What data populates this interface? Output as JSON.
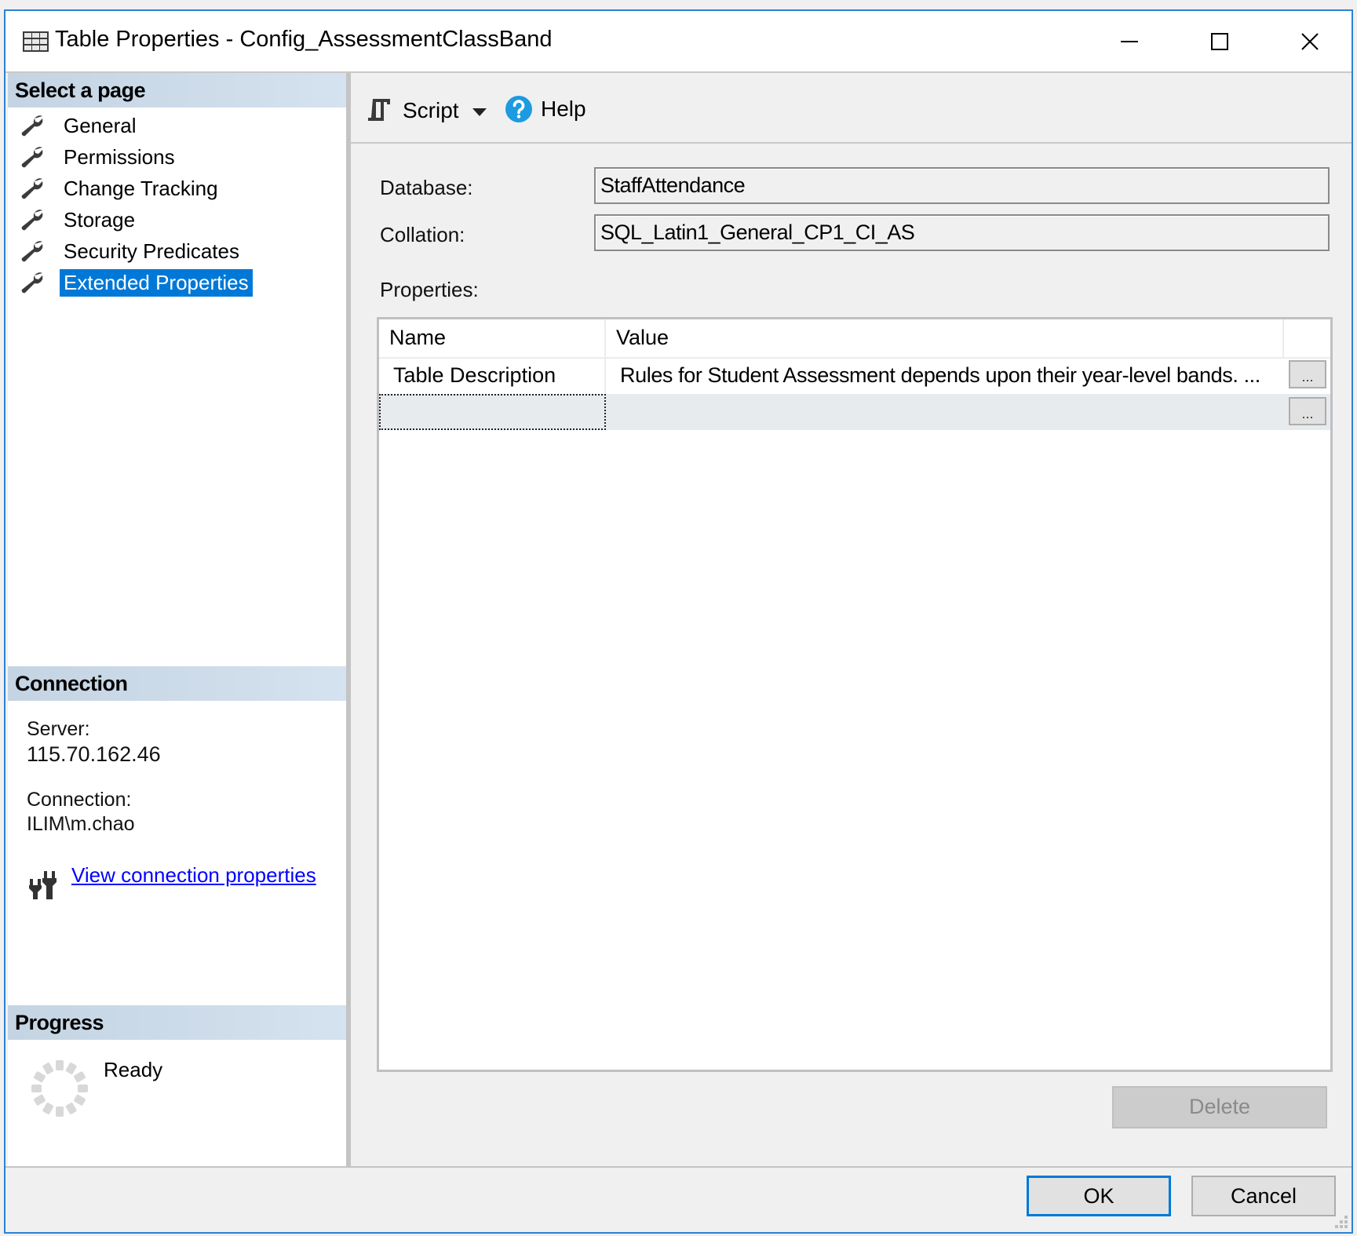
{
  "window": {
    "title": "Table Properties - Config_AssessmentClassBand",
    "icon": "table-grid-icon",
    "controls": {
      "minimize": "minimize-icon",
      "maximize": "maximize-icon",
      "close": "close-icon"
    }
  },
  "sidebar": {
    "header": "Select a page",
    "items": [
      {
        "label": "General",
        "icon": "wrench-icon",
        "selected": false
      },
      {
        "label": "Permissions",
        "icon": "wrench-icon",
        "selected": false
      },
      {
        "label": "Change Tracking",
        "icon": "wrench-icon",
        "selected": false
      },
      {
        "label": "Storage",
        "icon": "wrench-icon",
        "selected": false
      },
      {
        "label": "Security Predicates",
        "icon": "wrench-icon",
        "selected": false
      },
      {
        "label": "Extended Properties",
        "icon": "wrench-icon",
        "selected": true
      }
    ]
  },
  "connection": {
    "header": "Connection",
    "server_label": "Server:",
    "server_value": "115.70.162.46",
    "connection_label": "Connection:",
    "connection_value": "ILIM\\m.chao",
    "link_label": "View connection properties",
    "link_icon": "plug-icon"
  },
  "progress": {
    "header": "Progress",
    "status": "Ready",
    "icon": "spinner-icon"
  },
  "toolbar": {
    "script_label": "Script",
    "script_icon": "script-icon",
    "dropdown_icon": "chevron-down-icon",
    "help_label": "Help",
    "help_icon": "help-icon",
    "accent": "#1e9be0"
  },
  "form": {
    "database_label": "Database:",
    "database_value": "StaffAttendance",
    "collation_label": "Collation:",
    "collation_value": "SQL_Latin1_General_CP1_CI_AS",
    "properties_label": "Properties:"
  },
  "grid": {
    "columns": [
      "Name",
      "Value"
    ],
    "rows": [
      {
        "name": "Table Description",
        "value": "Rules for Student Assessment depends upon their year-level bands. ...",
        "button": "..."
      },
      {
        "name": "",
        "value": "",
        "button": "..."
      }
    ]
  },
  "buttons": {
    "delete": "Delete",
    "ok": "OK",
    "cancel": "Cancel"
  },
  "colors": {
    "selection": "#0078d7",
    "window_border": "#2b82d4",
    "link": "#0000ff"
  }
}
